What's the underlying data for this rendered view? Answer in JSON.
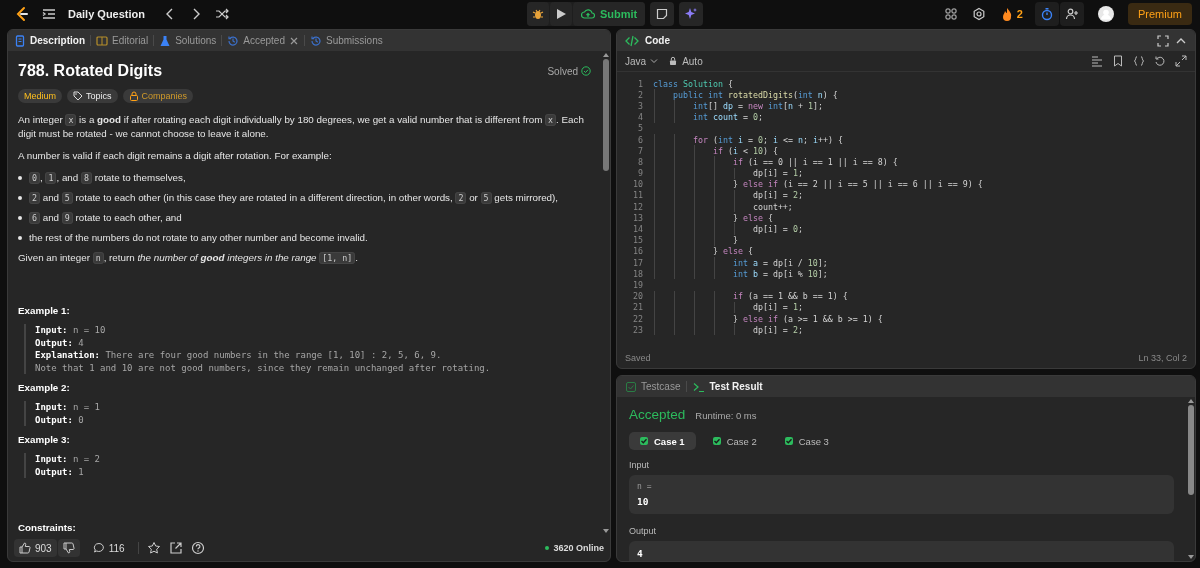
{
  "topbar": {
    "title": "Daily Question",
    "submit": "Submit",
    "streak": "2",
    "premium": "Premium"
  },
  "left_tabs": [
    {
      "label": "Description",
      "selected": true,
      "closable": false
    },
    {
      "label": "Editorial",
      "selected": false,
      "closable": false
    },
    {
      "label": "Solutions",
      "selected": false,
      "closable": false
    },
    {
      "label": "Accepted",
      "selected": false,
      "closable": true
    },
    {
      "label": "Submissions",
      "selected": false,
      "closable": false
    }
  ],
  "problem": {
    "title": "788. Rotated Digits",
    "status": "Solved",
    "tags": [
      {
        "kind": "difficulty",
        "label": "Medium"
      },
      {
        "kind": "topics",
        "label": "Topics"
      },
      {
        "kind": "companies",
        "label": "Companies"
      }
    ],
    "body": [
      {
        "kind": "para",
        "segments": [
          {
            "kind": "text",
            "text": "An integer "
          },
          {
            "kind": "code",
            "text": "x"
          },
          {
            "kind": "text",
            "text": " is a "
          },
          {
            "kind": "bold",
            "text": "good"
          },
          {
            "kind": "text",
            "text": " if after rotating each digit individually by 180 degrees, we get a valid number that is different from "
          },
          {
            "kind": "code",
            "text": "x"
          },
          {
            "kind": "text",
            "text": ". Each digit must be rotated - we cannot choose to leave it alone."
          }
        ]
      },
      {
        "kind": "para",
        "segments": [
          {
            "kind": "text",
            "text": "A number is valid if each digit remains a digit after rotation. For example:"
          }
        ]
      },
      {
        "kind": "bullet",
        "segments": [
          {
            "kind": "code",
            "text": "0"
          },
          {
            "kind": "text",
            "text": ", "
          },
          {
            "kind": "code",
            "text": "1"
          },
          {
            "kind": "text",
            "text": ", and "
          },
          {
            "kind": "code",
            "text": "8"
          },
          {
            "kind": "text",
            "text": " rotate to themselves,"
          }
        ]
      },
      {
        "kind": "bullet",
        "segments": [
          {
            "kind": "code",
            "text": "2"
          },
          {
            "kind": "text",
            "text": " and "
          },
          {
            "kind": "code",
            "text": "5"
          },
          {
            "kind": "text",
            "text": " rotate to each other (in this case they are rotated in a different direction, in other words, "
          },
          {
            "kind": "code",
            "text": "2"
          },
          {
            "kind": "text",
            "text": " or "
          },
          {
            "kind": "code",
            "text": "5"
          },
          {
            "kind": "text",
            "text": " gets mirrored),"
          }
        ]
      },
      {
        "kind": "bullet",
        "segments": [
          {
            "kind": "code",
            "text": "6"
          },
          {
            "kind": "text",
            "text": " and "
          },
          {
            "kind": "code",
            "text": "9"
          },
          {
            "kind": "text",
            "text": " rotate to each other, and"
          }
        ]
      },
      {
        "kind": "bullet",
        "segments": [
          {
            "kind": "text",
            "text": "the rest of the numbers do not rotate to any other number and become invalid."
          }
        ]
      },
      {
        "kind": "para",
        "segments": [
          {
            "kind": "text",
            "text": "Given an integer "
          },
          {
            "kind": "code",
            "text": "n"
          },
          {
            "kind": "text",
            "text": ", return "
          },
          {
            "kind": "italic",
            "text": "the number of "
          },
          {
            "kind": "bold-italic",
            "text": "good"
          },
          {
            "kind": "italic",
            "text": " integers in the range "
          },
          {
            "kind": "code",
            "text": "[1, n]"
          },
          {
            "kind": "text",
            "text": "."
          }
        ]
      }
    ],
    "examples": [
      {
        "title": "Example 1:",
        "lines": [
          {
            "label": "Input:",
            "value": "n = 10"
          },
          {
            "label": "Output:",
            "value": "4"
          },
          {
            "label": "Explanation:",
            "value": "There are four good numbers in the range [1, 10] : 2, 5, 6, 9."
          },
          {
            "value": "Note that 1 and 10 are not good numbers, since they remain unchanged after rotating."
          }
        ]
      },
      {
        "title": "Example 2:",
        "lines": [
          {
            "label": "Input:",
            "value": "n = 1"
          },
          {
            "label": "Output:",
            "value": "0"
          }
        ]
      },
      {
        "title": "Example 3:",
        "lines": [
          {
            "label": "Input:",
            "value": "n = 2"
          },
          {
            "label": "Output:",
            "value": "1"
          }
        ]
      }
    ],
    "constraints_heading": "Constraints:"
  },
  "footer": {
    "likes": "903",
    "comments": "116",
    "online": "3620 Online"
  },
  "code_panel": {
    "title": "Code",
    "language": "Java",
    "mode": "Auto",
    "status": "Saved",
    "cursor": "Ln 33, Col 2",
    "lines": [
      {
        "number": "1",
        "tokens": [
          {
            "kind": "ty",
            "text": "class "
          },
          {
            "kind": "cls",
            "text": "Solution"
          },
          {
            "kind": "p",
            "text": " {"
          }
        ]
      },
      {
        "number": "2",
        "tokens": [
          {
            "kind": "ty",
            "text": "    public int "
          },
          {
            "kind": "fn",
            "text": "rotatedDigits"
          },
          {
            "kind": "p",
            "text": "("
          },
          {
            "kind": "ty",
            "text": "int "
          },
          {
            "kind": "var",
            "text": "n"
          },
          {
            "kind": "p",
            "text": ") {"
          }
        ]
      },
      {
        "number": "3",
        "tokens": [
          {
            "kind": "ty",
            "text": "        int"
          },
          {
            "kind": "p",
            "text": "[] "
          },
          {
            "kind": "var",
            "text": "dp"
          },
          {
            "kind": "p",
            "text": " = "
          },
          {
            "kind": "kw",
            "text": "new "
          },
          {
            "kind": "ty",
            "text": "int"
          },
          {
            "kind": "p",
            "text": "["
          },
          {
            "kind": "var",
            "text": "n"
          },
          {
            "kind": "p",
            "text": " + "
          },
          {
            "kind": "num",
            "text": "1"
          },
          {
            "kind": "p",
            "text": "];"
          }
        ]
      },
      {
        "number": "4",
        "tokens": [
          {
            "kind": "ty",
            "text": "        int "
          },
          {
            "kind": "var",
            "text": "count"
          },
          {
            "kind": "p",
            "text": " = "
          },
          {
            "kind": "num",
            "text": "0"
          },
          {
            "kind": "p",
            "text": ";"
          }
        ]
      },
      {
        "number": "5"
      },
      {
        "number": "6",
        "tokens": [
          {
            "kind": "kw",
            "text": "        for"
          },
          {
            "kind": "p",
            "text": " ("
          },
          {
            "kind": "ty",
            "text": "int "
          },
          {
            "kind": "var",
            "text": "i"
          },
          {
            "kind": "p",
            "text": " = "
          },
          {
            "kind": "num",
            "text": "0"
          },
          {
            "kind": "p",
            "text": "; "
          },
          {
            "kind": "var",
            "text": "i"
          },
          {
            "kind": "p",
            "text": " <= "
          },
          {
            "kind": "var",
            "text": "n"
          },
          {
            "kind": "p",
            "text": "; "
          },
          {
            "kind": "var",
            "text": "i"
          },
          {
            "kind": "p",
            "text": "++) {"
          }
        ]
      },
      {
        "number": "7",
        "tokens": [
          {
            "kind": "kw",
            "text": "            if"
          },
          {
            "kind": "p",
            "text": " ("
          },
          {
            "kind": "var",
            "text": "i"
          },
          {
            "kind": "p",
            "text": " < "
          },
          {
            "kind": "num",
            "text": "10"
          },
          {
            "kind": "p",
            "text": ") {"
          }
        ]
      },
      {
        "number": "8",
        "tokens": [
          {
            "kind": "kw",
            "text": "                if"
          },
          {
            "kind": "p",
            "text": " (i == 0 || i == 1 || i == 8) {"
          }
        ]
      },
      {
        "number": "9",
        "tokens": [
          {
            "kind": "p",
            "text": "                    dp[i] = "
          },
          {
            "kind": "num",
            "text": "1"
          },
          {
            "kind": "p",
            "text": ";"
          }
        ]
      },
      {
        "number": "10",
        "tokens": [
          {
            "kind": "p",
            "text": "                } "
          },
          {
            "kind": "kw",
            "text": "else if"
          },
          {
            "kind": "p",
            "text": " (i == 2 || i == 5 || i == 6 || i == 9) {"
          }
        ]
      },
      {
        "number": "11",
        "tokens": [
          {
            "kind": "p",
            "text": "                    dp[i] = "
          },
          {
            "kind": "num",
            "text": "2"
          },
          {
            "kind": "p",
            "text": ";"
          }
        ]
      },
      {
        "number": "12",
        "tokens": [
          {
            "kind": "p",
            "text": "                    count++;"
          }
        ]
      },
      {
        "number": "13",
        "tokens": [
          {
            "kind": "p",
            "text": "                } "
          },
          {
            "kind": "kw",
            "text": "else"
          },
          {
            "kind": "p",
            "text": " {"
          }
        ]
      },
      {
        "number": "14",
        "tokens": [
          {
            "kind": "p",
            "text": "                    dp[i] = "
          },
          {
            "kind": "num",
            "text": "0"
          },
          {
            "kind": "p",
            "text": ";"
          }
        ]
      },
      {
        "number": "15",
        "tokens": [
          {
            "kind": "p",
            "text": "                }"
          }
        ]
      },
      {
        "number": "16",
        "tokens": [
          {
            "kind": "p",
            "text": "            } "
          },
          {
            "kind": "kw",
            "text": "else"
          },
          {
            "kind": "p",
            "text": " {"
          }
        ]
      },
      {
        "number": "17",
        "tokens": [
          {
            "kind": "ty",
            "text": "                int "
          },
          {
            "kind": "var",
            "text": "a"
          },
          {
            "kind": "p",
            "text": " = dp[i / "
          },
          {
            "kind": "num",
            "text": "10"
          },
          {
            "kind": "p",
            "text": "];"
          }
        ]
      },
      {
        "number": "18",
        "tokens": [
          {
            "kind": "ty",
            "text": "                int "
          },
          {
            "kind": "var",
            "text": "b"
          },
          {
            "kind": "p",
            "text": " = dp[i % "
          },
          {
            "kind": "num",
            "text": "10"
          },
          {
            "kind": "p",
            "text": "];"
          }
        ]
      },
      {
        "number": "19"
      },
      {
        "number": "20",
        "tokens": [
          {
            "kind": "kw",
            "text": "                if"
          },
          {
            "kind": "p",
            "text": " (a == 1 && b == 1) {"
          }
        ]
      },
      {
        "number": "21",
        "tokens": [
          {
            "kind": "p",
            "text": "                    dp[i] = "
          },
          {
            "kind": "num",
            "text": "1"
          },
          {
            "kind": "p",
            "text": ";"
          }
        ]
      },
      {
        "number": "22",
        "tokens": [
          {
            "kind": "p",
            "text": "                } "
          },
          {
            "kind": "kw",
            "text": "else if"
          },
          {
            "kind": "p",
            "text": " (a >= 1 && b >= 1) {"
          }
        ]
      },
      {
        "number": "23",
        "tokens": [
          {
            "kind": "p",
            "text": "                    dp[i] = "
          },
          {
            "kind": "num",
            "text": "2"
          },
          {
            "kind": "p",
            "text": ";"
          }
        ]
      }
    ]
  },
  "test_panel": {
    "tabs": [
      {
        "label": "Testcase",
        "selected": false
      },
      {
        "label": "Test Result",
        "selected": true
      }
    ],
    "verdict": "Accepted",
    "runtime": "Runtime: 0 ms",
    "cases": [
      {
        "label": "Case 1",
        "selected": true,
        "passed": true
      },
      {
        "label": "Case 2",
        "selected": false,
        "passed": true
      },
      {
        "label": "Case 3",
        "selected": false,
        "passed": true
      }
    ],
    "input_label": "Input",
    "input_name": "n =",
    "input_value": "10",
    "output_label": "Output",
    "output_value": "4"
  }
}
